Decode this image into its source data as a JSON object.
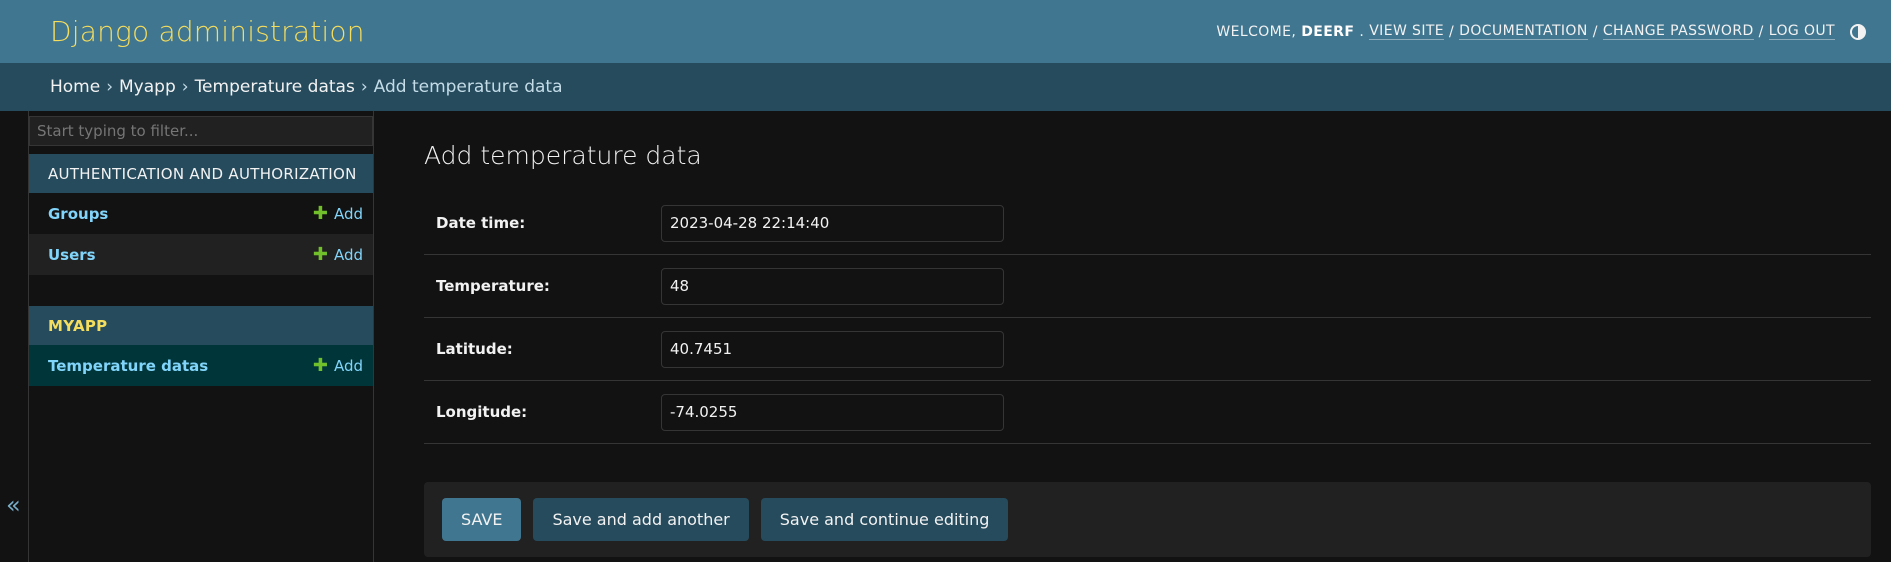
{
  "header": {
    "site_title": "Django administration",
    "welcome_text": "Welcome,",
    "username": "deerf",
    "links": [
      "View site",
      "Documentation",
      "Change password",
      "Log out"
    ]
  },
  "breadcrumbs": [
    "Home",
    "Myapp",
    "Temperature datas",
    "Add temperature data"
  ],
  "sidebar": {
    "filter_placeholder": "Start typing to filter...",
    "modules": [
      {
        "caption": "Authentication and Authorization",
        "models": [
          {
            "name": "Groups",
            "add": "Add"
          },
          {
            "name": "Users",
            "add": "Add"
          }
        ]
      },
      {
        "caption": "Myapp",
        "models": [
          {
            "name": "Temperature datas",
            "add": "Add"
          }
        ]
      }
    ],
    "collapse_icon": "«"
  },
  "form": {
    "title": "Add temperature data",
    "fields": [
      {
        "label": "Date time:",
        "value": "2023-04-28 22:14:40"
      },
      {
        "label": "Temperature:",
        "value": "48"
      },
      {
        "label": "Latitude:",
        "value": "40.7451"
      },
      {
        "label": "Longitude:",
        "value": "-74.0255"
      }
    ],
    "buttons": {
      "save": "Save",
      "save_add_another": "Save and add another",
      "save_continue": "Save and continue editing"
    }
  },
  "colors": {
    "header_bg": "#417690",
    "breadcrumbs_bg": "#264b5d",
    "accent_yellow": "#f5dd5d",
    "link_blue": "#81d4fa",
    "add_green": "#70bf2b"
  }
}
